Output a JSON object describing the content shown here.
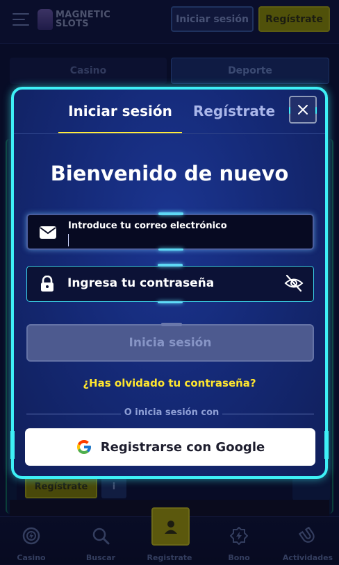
{
  "header": {
    "logo_line1": "MAGNETIC",
    "logo_line2": "SLOTS",
    "login_label": "Iniciar sesión",
    "register_label": "Regístrate"
  },
  "category_tabs": [
    {
      "label": "Casino",
      "active": false
    },
    {
      "label": "Deporte",
      "active": true
    }
  ],
  "background": {
    "register_label": "Regístrate",
    "info_label": "i"
  },
  "modal": {
    "tabs": {
      "login": "Iniciar sesión",
      "register": "Regístrate"
    },
    "title": "Bienvenido de nuevo",
    "email": {
      "label": "Introduce tu correo electrónico",
      "value": ""
    },
    "password": {
      "placeholder": "Ingresa tu contraseña",
      "value": ""
    },
    "submit_label": "Inicia sesión",
    "forgot_label": "¿Has olvidado tu contraseña?",
    "divider_label": "O inicia sesión con",
    "google_label": "Registrarse con Google",
    "icons": {
      "email": "envelope-icon",
      "password": "lock-icon",
      "visibility": "eye-slash-icon",
      "close": "close-icon",
      "google": "google-icon"
    }
  },
  "bottom_nav": [
    {
      "label": "Casino",
      "icon": "casino-chip-icon"
    },
    {
      "label": "Buscar",
      "icon": "search-icon"
    },
    {
      "label": "Registrate",
      "icon": "user-icon"
    },
    {
      "label": "Bono",
      "icon": "lightning-badge-icon"
    },
    {
      "label": "Actividades",
      "icon": "magnet-icon"
    }
  ],
  "colors": {
    "accent_cyan": "#3ef0f6",
    "accent_yellow": "#ffe62e",
    "modal_bg": "#152a78",
    "page_bg": "#0b1030"
  }
}
